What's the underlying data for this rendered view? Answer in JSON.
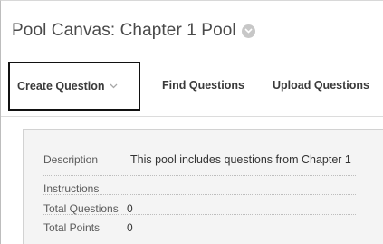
{
  "header": {
    "title": "Pool Canvas: Chapter 1 Pool",
    "title_menu_icon": "circle-chevron-down-icon"
  },
  "toolbar": {
    "create_question_label": "Create Question",
    "create_question_icon": "chevron-down-icon",
    "find_questions_label": "Find Questions",
    "upload_questions_label": "Upload Questions"
  },
  "pool_info": {
    "description_label": "Description",
    "description_value": "This pool includes questions from Chapter 1",
    "instructions_label": "Instructions",
    "instructions_value": "",
    "total_questions_label": "Total Questions",
    "total_questions_value": "0",
    "total_points_label": "Total Points",
    "total_points_value": "0"
  },
  "colors": {
    "title_text": "#4a4a4a",
    "toolbar_text": "#3a3a3a",
    "highlight_border": "#111111",
    "info_background": "#f4f4f4"
  }
}
